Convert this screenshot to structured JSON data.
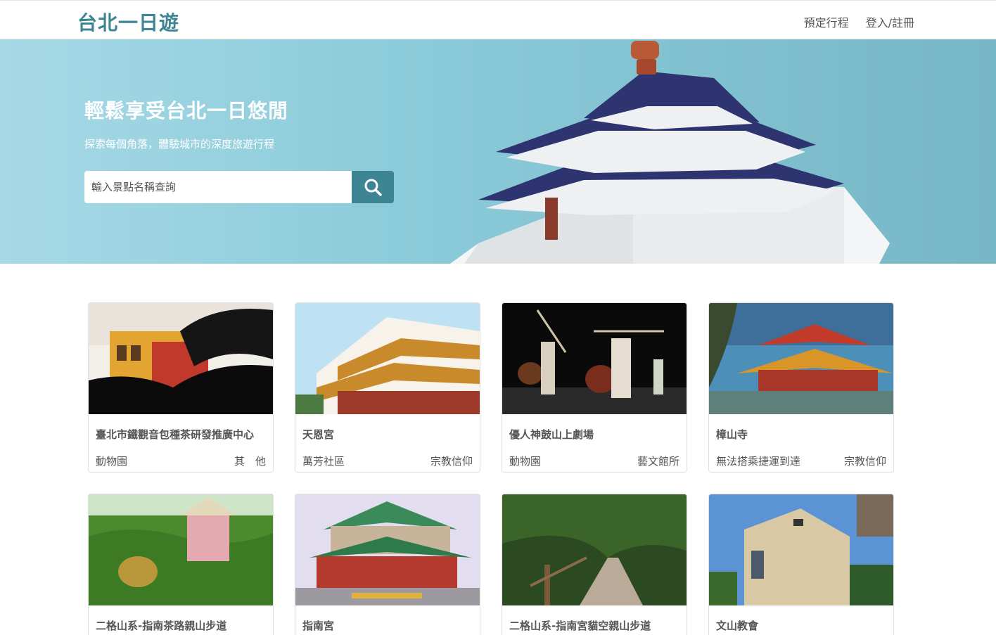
{
  "nav": {
    "brand": "台北一日遊",
    "links": [
      "預定行程",
      "登入/註冊"
    ]
  },
  "hero": {
    "title": "輕鬆享受台北一日悠閒",
    "subtitle": "探索每個角落，體驗城市的深度旅遊行程",
    "search_placeholder": "輸入景點名稱查詢",
    "search_icon": "search-icon"
  },
  "colors": {
    "accent": "#3e8593",
    "hero_bg": "#8ccbd9"
  },
  "attractions": [
    {
      "title": "臺北市鐵觀音包種茶研發推廣中心",
      "mrt": "動物園",
      "category": "其　他",
      "image": "building-sunset"
    },
    {
      "title": "天恩宮",
      "mrt": "萬芳社區",
      "category": "宗教信仰",
      "image": "temple"
    },
    {
      "title": "優人神鼓山上劇場",
      "mrt": "動物園",
      "category": "藝文館所",
      "image": "drum-performance"
    },
    {
      "title": "樟山寺",
      "mrt": "無法搭乘捷運到達",
      "category": "宗教信仰",
      "image": "temple-roof"
    },
    {
      "title": "二格山系-指南茶路親山步道",
      "mrt": "",
      "category": "",
      "image": "tea-picker"
    },
    {
      "title": "指南宮",
      "mrt": "",
      "category": "",
      "image": "temple-garden"
    },
    {
      "title": "二格山系-指南宮貓空親山步道",
      "mrt": "",
      "category": "",
      "image": "forest-trail"
    },
    {
      "title": "文山教會",
      "mrt": "",
      "category": "",
      "image": "church"
    }
  ]
}
